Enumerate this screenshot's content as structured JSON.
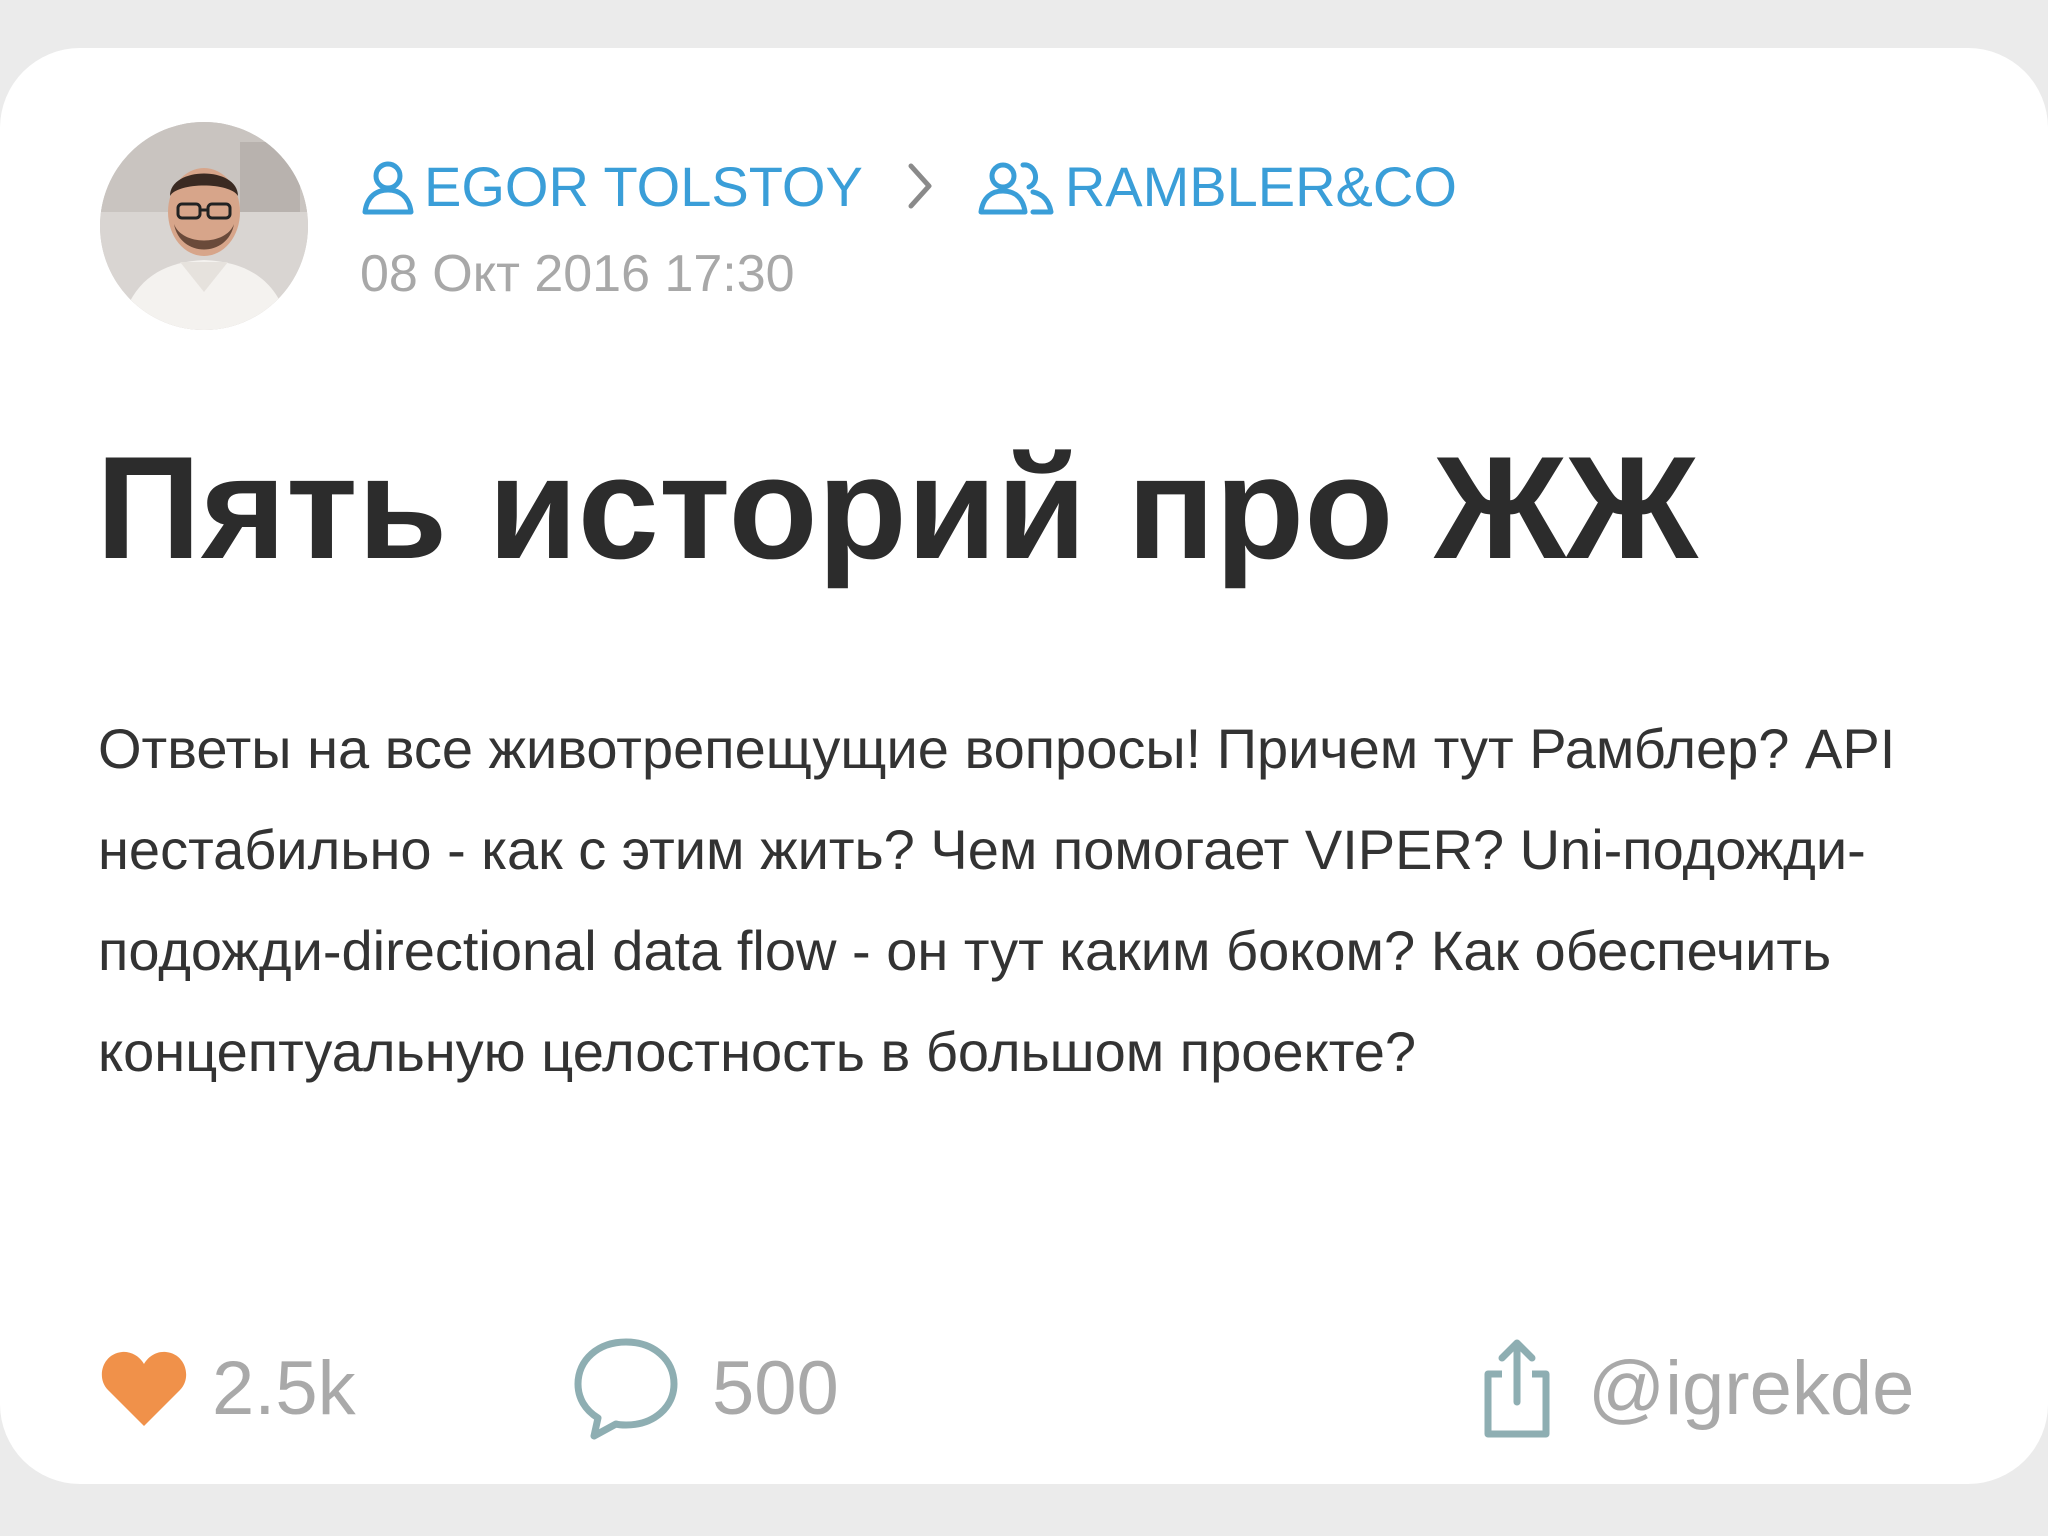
{
  "post": {
    "author": "EGOR TOLSTOY",
    "community": "RAMBLER&CO",
    "date": "08 Окт 2016 17:30",
    "title": "Пять историй про ЖЖ",
    "description": "Ответы на все животрепещущие вопросы! Причем тут Рамблер? API нестабильно - как с этим жить? Чем помогает VIPER? Uni-подожди-подожди-directional data flow - он тут каким боком? Как обеспечить концептуальную целостность в большом проекте?"
  },
  "actions": {
    "likes": "2.5k",
    "comments": "500",
    "share_handle": "@igrekde"
  },
  "icons": {
    "author": "user-icon",
    "separator": "chevron-right-icon",
    "community": "group-icon",
    "like": "heart-icon",
    "comment": "comment-bubble-icon",
    "share": "share-icon"
  },
  "colors": {
    "link": "#3a9ed8",
    "heart": "#f0914a",
    "muted": "#a9a9a9",
    "title": "#2c2c2c",
    "text": "#333333"
  }
}
